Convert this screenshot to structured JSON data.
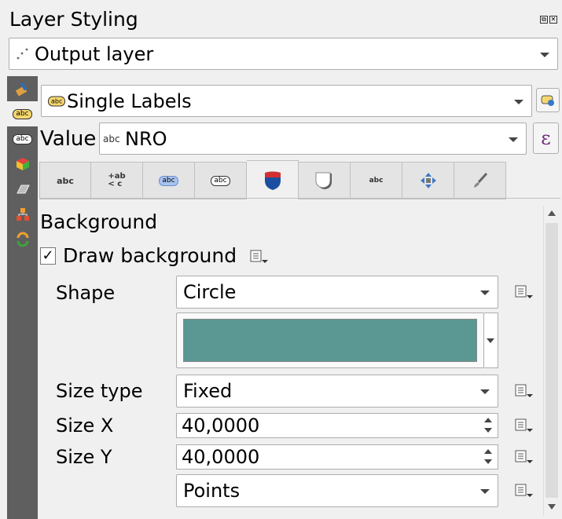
{
  "panel": {
    "title": "Layer Styling",
    "float_button": "⧉",
    "close_button": "✕"
  },
  "layer_select": {
    "value": "Output layer"
  },
  "sidebar": {
    "items": [
      {
        "icon": "paintbrush-icon"
      },
      {
        "icon": "labels-icon",
        "text": "abc",
        "active": true
      },
      {
        "icon": "label-mask-icon",
        "text": "abc"
      },
      {
        "icon": "3d-view-icon"
      },
      {
        "icon": "diagrams-icon"
      },
      {
        "icon": "fields-icon"
      },
      {
        "icon": "history-icon"
      }
    ]
  },
  "labeling": {
    "mode": "Single Labels",
    "value_label": "Value",
    "value_prefix": "abc",
    "value": "NRO",
    "expression_button": "ε"
  },
  "tabs": [
    {
      "name": "text",
      "text": "abc"
    },
    {
      "name": "formatting",
      "text": "+ab\n< c"
    },
    {
      "name": "buffer",
      "text": "abc"
    },
    {
      "name": "mask",
      "text": "abc"
    },
    {
      "name": "background",
      "active": true
    },
    {
      "name": "shadow"
    },
    {
      "name": "callouts",
      "text": "abc"
    },
    {
      "name": "placement"
    },
    {
      "name": "rendering"
    }
  ],
  "background": {
    "section_title": "Background",
    "draw_background_label": "Draw background",
    "draw_background_checked": true,
    "check_mark": "✓",
    "shape_label": "Shape",
    "shape_value": "Circle",
    "fill_color": "#5b9894",
    "size_type_label": "Size type",
    "size_type_value": "Fixed",
    "size_x_label": "Size X",
    "size_x_value": "40,0000",
    "size_y_label": "Size Y",
    "size_y_value": "40,0000",
    "units_value": "Points"
  },
  "colors": {
    "sidebar_bg": "#5f5f5f",
    "panel_bg": "#f0f0f0",
    "accent_red": "#d32f2f",
    "accent_blue": "#1c4fa0"
  }
}
